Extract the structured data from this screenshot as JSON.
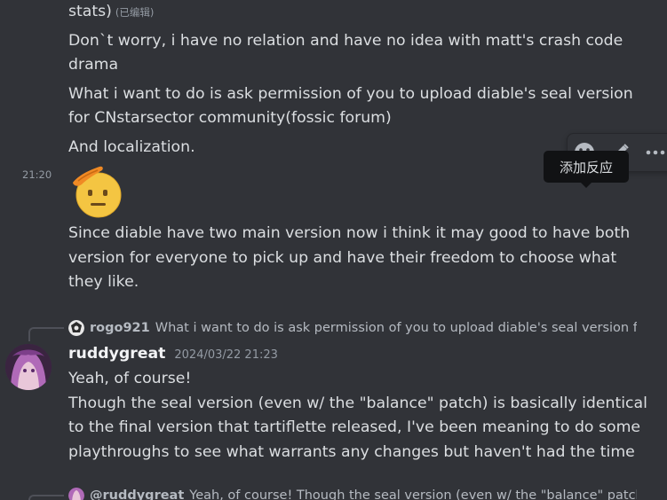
{
  "messages_prev": {
    "line_stats": "stats)",
    "edited_tag": "(已编辑)",
    "line1a": "Don`t worry, i have no relation and have no idea with matt's crash code",
    "line1b": "drama",
    "line2a": "What i want to do is ask permission of you to upload diable's seal version",
    "line2b": "for CNstarsector community(fossic forum)",
    "line3": "And localization.",
    "timestamp": "21:20",
    "emoji_name": "saluting-face",
    "line4a": "Since diable have two main version now i think it may good to have both",
    "line4b": "version for everyone to pick up and have their freedom to choose what",
    "line4c": "they like."
  },
  "toolbar": {
    "tooltip": "添加反应",
    "icons": [
      "add-reaction-icon",
      "edit-icon",
      "more-icon"
    ]
  },
  "reply1": {
    "name": "rogo921",
    "text": "What i want to do is ask permission of you to upload diable's seal version fo"
  },
  "message_main": {
    "author": "ruddygreat",
    "timestamp": "2024/03/22 21:23",
    "line1": "Yeah, of course!",
    "line2": "Though the seal version (even w/ the \"balance\" patch) is basically identical",
    "line3": "to the final version that tartiflette released, I've been meaning to do some",
    "line4": "playthroughs to see what warrants any changes but haven't had the time"
  },
  "reply2": {
    "name": "@ruddygreat",
    "text": "Yeah, of course! Though the seal version (even w/ the \"balance\" patch"
  },
  "colors": {
    "background": "#313338",
    "text": "#dbdee1",
    "muted": "#949ba4",
    "tooltip_bg": "#111214"
  }
}
